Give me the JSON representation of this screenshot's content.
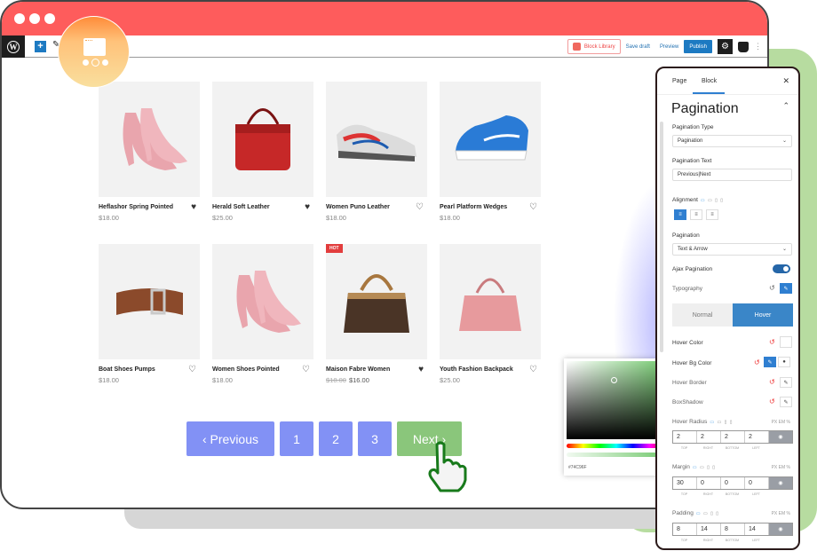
{
  "toolbar": {
    "block_library": "Block Library",
    "save_draft": "Save draft",
    "preview": "Preview",
    "publish": "Publish",
    "add_symbol": "+",
    "kebab": "⋮"
  },
  "products": [
    {
      "name": "Heflashor Spring Pointed",
      "price": "$18.00",
      "favorited": true
    },
    {
      "name": "Herald Soft Leather",
      "price": "$25.00",
      "favorited": true
    },
    {
      "name": "Women Puno Leather",
      "price": "$18.00",
      "favorited": false
    },
    {
      "name": "Pearl Platform Wedges",
      "price": "$18.00",
      "favorited": false
    },
    {
      "name": "Boat Shoes Pumps",
      "price": "$18.00",
      "favorited": false
    },
    {
      "name": "Women Shoes Pointed",
      "price": "$18.00",
      "favorited": false
    },
    {
      "name": "Maison Fabre Women",
      "old_price": "$18.00",
      "price": "$16.00",
      "favorited": true,
      "badge": "HOT"
    },
    {
      "name": "Youth Fashion Backpack",
      "price": "$25.00",
      "favorited": false
    }
  ],
  "pagination": {
    "previous": "‹ Previous",
    "pages": [
      "1",
      "2",
      "3"
    ],
    "next": "Next ›",
    "button_color": "#8291f5",
    "hover_color": "#8ac67b"
  },
  "color_picker": {
    "hex": "#74C96F"
  },
  "panel": {
    "tabs": [
      "Page",
      "Block"
    ],
    "active_tab": "Block",
    "title": "Pagination",
    "pagination_type_label": "Pagination Type",
    "pagination_type_value": "Pagination",
    "pagination_text_label": "Pagination Text",
    "pagination_text_value": "Previous|Next",
    "alignment_label": "Alignment",
    "pagination_label": "Pagination",
    "pagination_value": "Text & Arrow",
    "ajax_label": "Ajax Pagination",
    "ajax_enabled": true,
    "typography_label": "Typography",
    "state_tabs": [
      "Normal",
      "Hover"
    ],
    "active_state": "Hover",
    "hover_color_label": "Hover Color",
    "hover_bg_label": "Hover Bg Color",
    "hover_border_label": "Hover Border",
    "boxshadow_label": "BoxShadow",
    "units": "PX EM %",
    "dim_labels": [
      "TOP",
      "RIGHT",
      "BOTTOM",
      "LEFT"
    ],
    "hover_radius": {
      "label": "Hover Radius",
      "values": [
        "2",
        "2",
        "2",
        "2"
      ]
    },
    "margin": {
      "label": "Margin",
      "values": [
        "30",
        "0",
        "0",
        "0"
      ]
    },
    "padding": {
      "label": "Padding",
      "values": [
        "8",
        "14",
        "8",
        "14"
      ]
    }
  }
}
